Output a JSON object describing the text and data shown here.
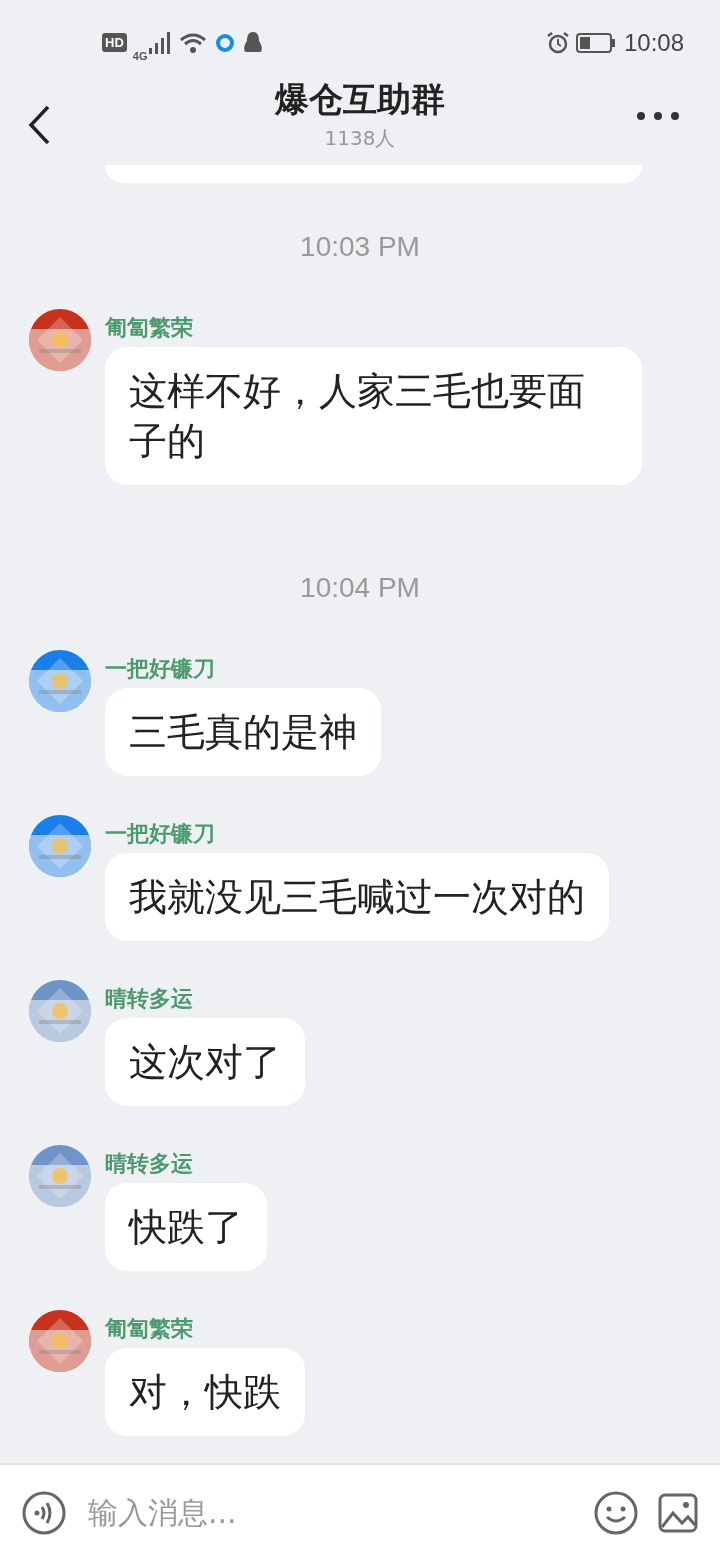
{
  "status_bar": {
    "hd": "HD",
    "network": "4G",
    "time": "10:08"
  },
  "header": {
    "title": "爆仓互助群",
    "subtitle": "1138人"
  },
  "messages": [
    {
      "kind": "time",
      "text": "10:03 PM"
    },
    {
      "kind": "message",
      "sender": "匍匐繁荣",
      "color": "#c8321c",
      "text": "这样不好，人家三毛也要面子的"
    },
    {
      "kind": "time",
      "text": "10:04 PM"
    },
    {
      "kind": "message",
      "sender": "一把好镰刀",
      "color": "#1a7ee8",
      "text": "三毛真的是神"
    },
    {
      "kind": "message",
      "sender": "一把好镰刀",
      "color": "#1a7ee8",
      "text": "我就没见三毛喊过一次对的"
    },
    {
      "kind": "message",
      "sender": "晴转多运",
      "color": "#6f94c8",
      "text": "这次对了"
    },
    {
      "kind": "message",
      "sender": "晴转多运",
      "color": "#6f94c8",
      "text": "快跌了"
    },
    {
      "kind": "message",
      "sender": "匍匐繁荣",
      "color": "#c8321c",
      "text": "对，快跌"
    }
  ],
  "input": {
    "placeholder": "输入消息..."
  }
}
